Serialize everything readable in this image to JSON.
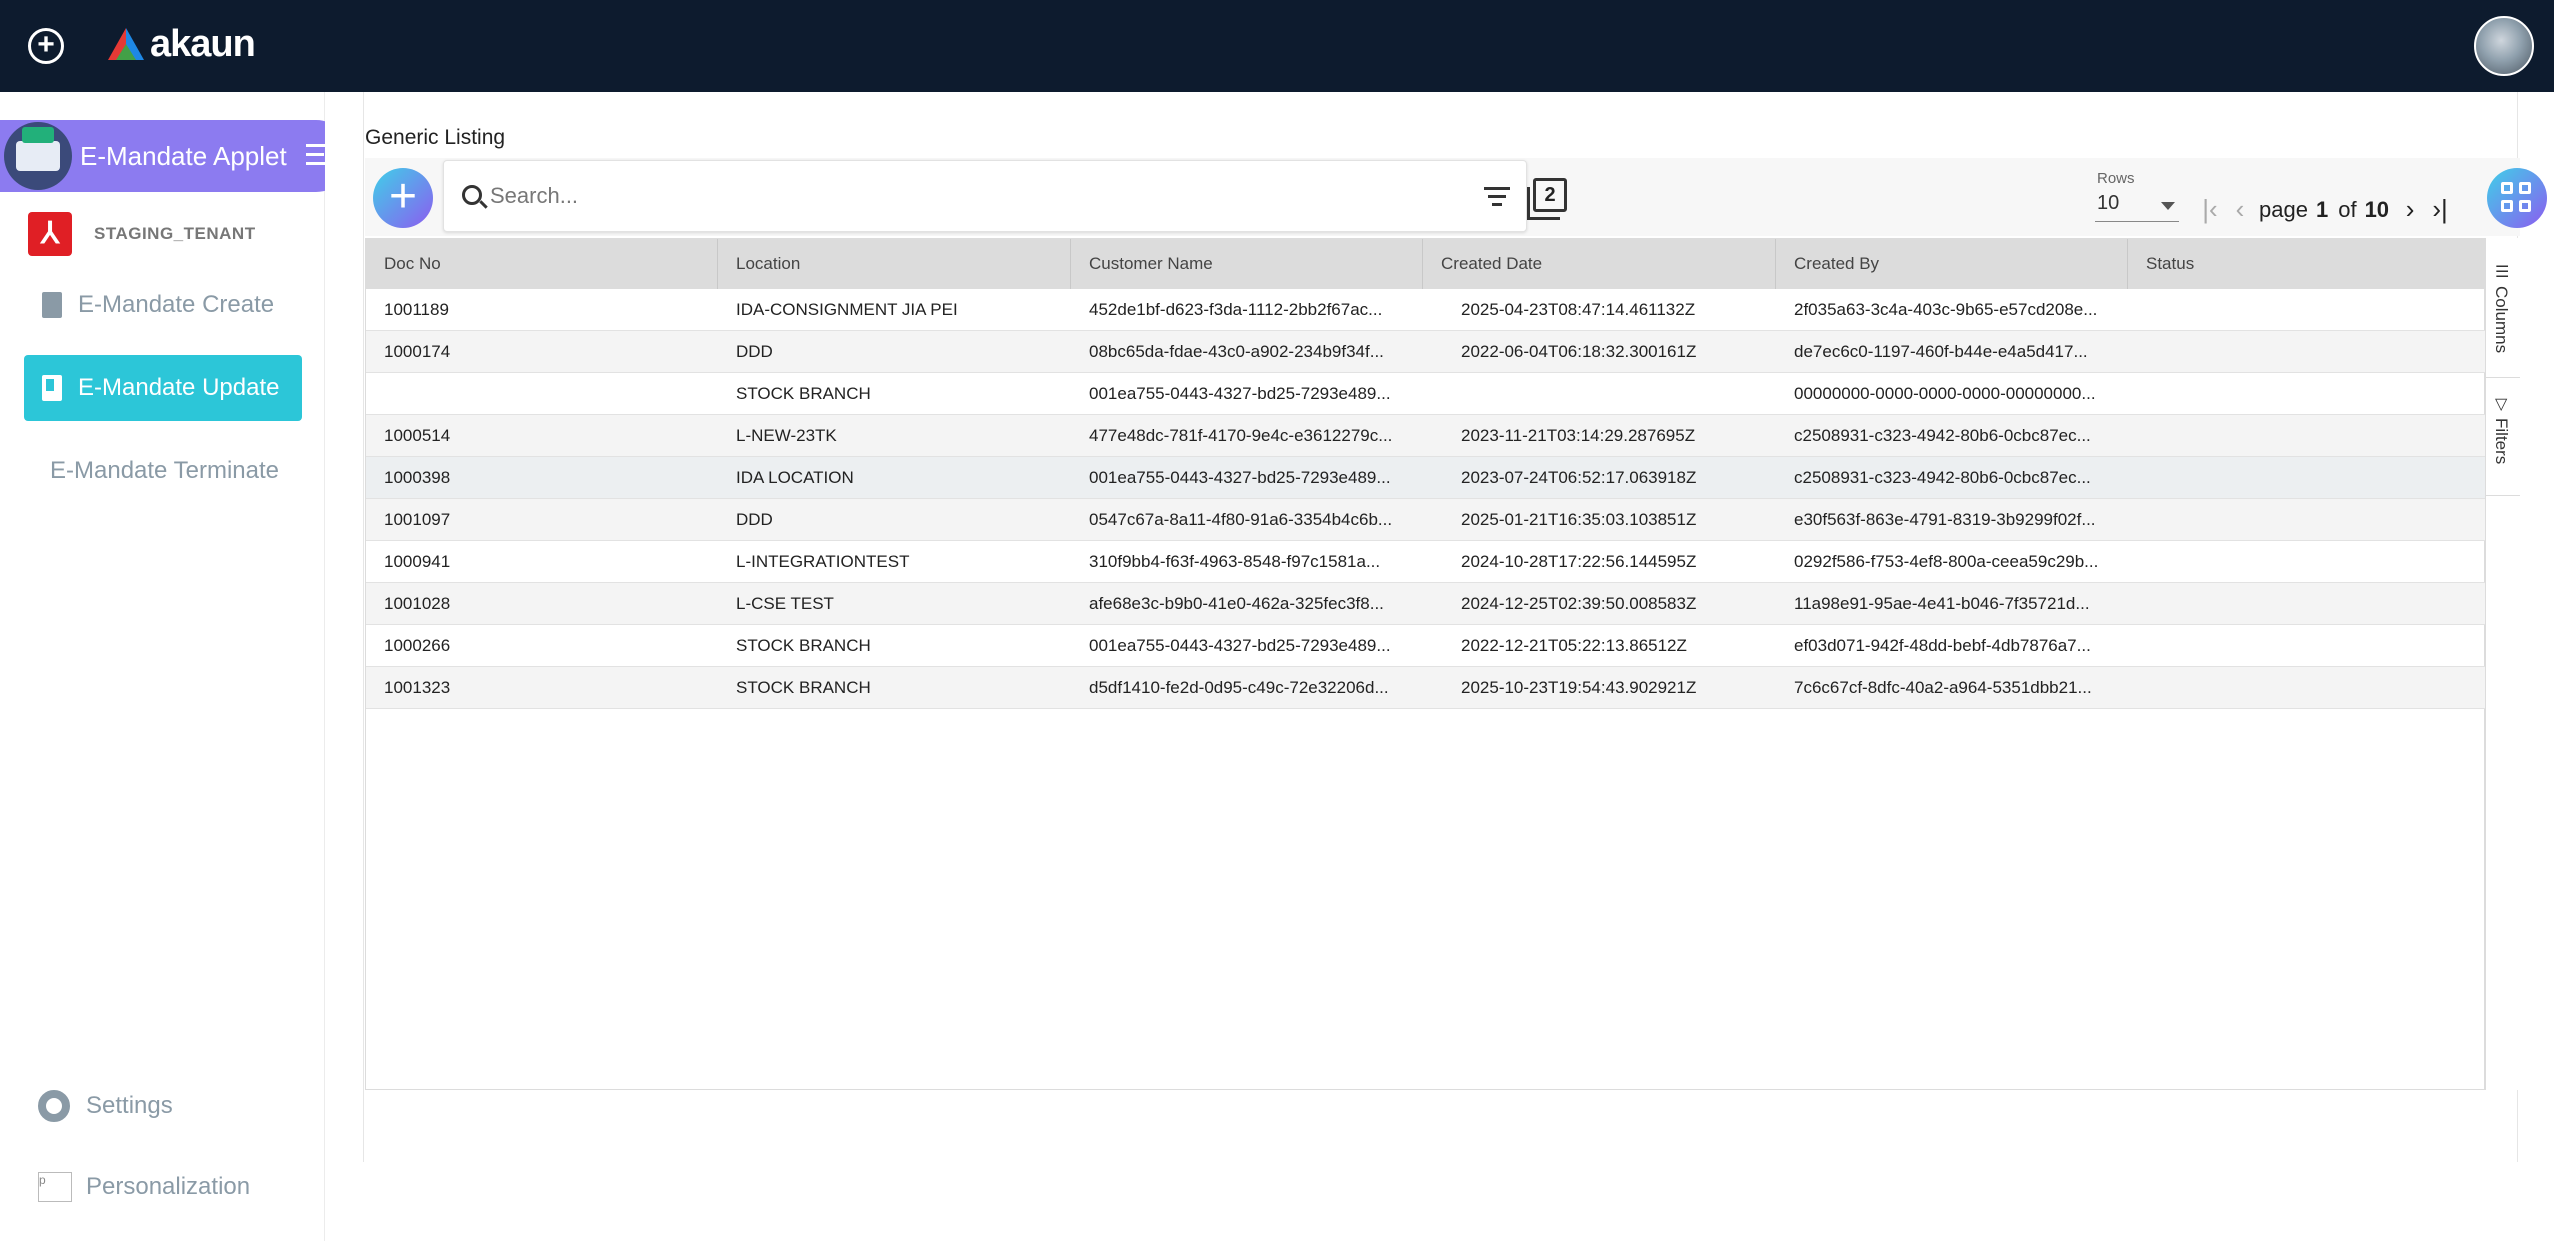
{
  "topbar": {
    "logo_text": "akaun"
  },
  "sidebar": {
    "applet_title": "E-Mandate Applet",
    "tenant_name": "STAGING_TENANT",
    "items": [
      {
        "label": "E-Mandate Create",
        "active": false,
        "icon": "doc-icon"
      },
      {
        "label": "E-Mandate Update",
        "active": true,
        "icon": "doc-icon"
      },
      {
        "label": "E-Mandate Terminate",
        "active": false,
        "icon": "none"
      }
    ],
    "settings_label": "Settings",
    "personalization_label": "Personalization",
    "personalization_alt": "p"
  },
  "main": {
    "page_title": "Generic Listing",
    "search": {
      "placeholder": "Search..."
    },
    "copy_count": "2",
    "rows": {
      "label": "Rows",
      "value": "10"
    },
    "pager": {
      "page_word": "page",
      "current": "1",
      "of_word": "of",
      "total": "10"
    },
    "side_tabs": {
      "columns": "Columns",
      "filters": "Filters"
    }
  },
  "table": {
    "columns": [
      "Doc No",
      "Location",
      "Customer Name",
      "Created Date",
      "Created By",
      "Status"
    ],
    "rows": [
      [
        "1001189",
        "IDA-CONSIGNMENT JIA PEI",
        "452de1bf-d623-f3da-1112-2bb2f67ac...",
        "2025-04-23T08:47:14.461132Z",
        "2f035a63-3c4a-403c-9b65-e57cd208e...",
        ""
      ],
      [
        "1000174",
        "DDD",
        "08bc65da-fdae-43c0-a902-234b9f34f...",
        "2022-06-04T06:18:32.300161Z",
        "de7ec6c0-1197-460f-b44e-e4a5d417...",
        ""
      ],
      [
        "",
        "STOCK BRANCH",
        "001ea755-0443-4327-bd25-7293e489...",
        "",
        "00000000-0000-0000-0000-00000000...",
        ""
      ],
      [
        "1000514",
        "L-NEW-23TK",
        "477e48dc-781f-4170-9e4c-e3612279c...",
        "2023-11-21T03:14:29.287695Z",
        "c2508931-c323-4942-80b6-0cbc87ec...",
        ""
      ],
      [
        "1000398",
        "IDA LOCATION",
        "001ea755-0443-4327-bd25-7293e489...",
        "2023-07-24T06:52:17.063918Z",
        "c2508931-c323-4942-80b6-0cbc87ec...",
        ""
      ],
      [
        "1001097",
        "DDD",
        "0547c67a-8a11-4f80-91a6-3354b4c6b...",
        "2025-01-21T16:35:03.103851Z",
        "e30f563f-863e-4791-8319-3b9299f02f...",
        ""
      ],
      [
        "1000941",
        "L-INTEGRATIONTEST",
        "310f9bb4-f63f-4963-8548-f97c1581a...",
        "2024-10-28T17:22:56.144595Z",
        "0292f586-f753-4ef8-800a-ceea59c29b...",
        ""
      ],
      [
        "1001028",
        "L-CSE TEST",
        "afe68e3c-b9b0-41e0-462a-325fec3f8...",
        "2024-12-25T02:39:50.008583Z",
        "11a98e91-95ae-4e41-b046-7f35721d...",
        ""
      ],
      [
        "1000266",
        "STOCK BRANCH",
        "001ea755-0443-4327-bd25-7293e489...",
        "2022-12-21T05:22:13.86512Z",
        "ef03d071-942f-48dd-bebf-4db7876a7...",
        ""
      ],
      [
        "1001323",
        "STOCK BRANCH",
        "d5df1410-fe2d-0d95-c49c-72e32206d...",
        "2025-10-23T19:54:43.902921Z",
        "7c6c67cf-8dfc-40a2-a964-5351dbb21...",
        ""
      ]
    ]
  },
  "colors": {
    "topbar": "#0d1b2e",
    "applet_pill": "#8c7bf0",
    "active_nav": "#2cc6d8",
    "accent_gradient_start": "#3fd0e8",
    "accent_gradient_end": "#8c5cf0",
    "tenant_logo": "#e01f25"
  }
}
